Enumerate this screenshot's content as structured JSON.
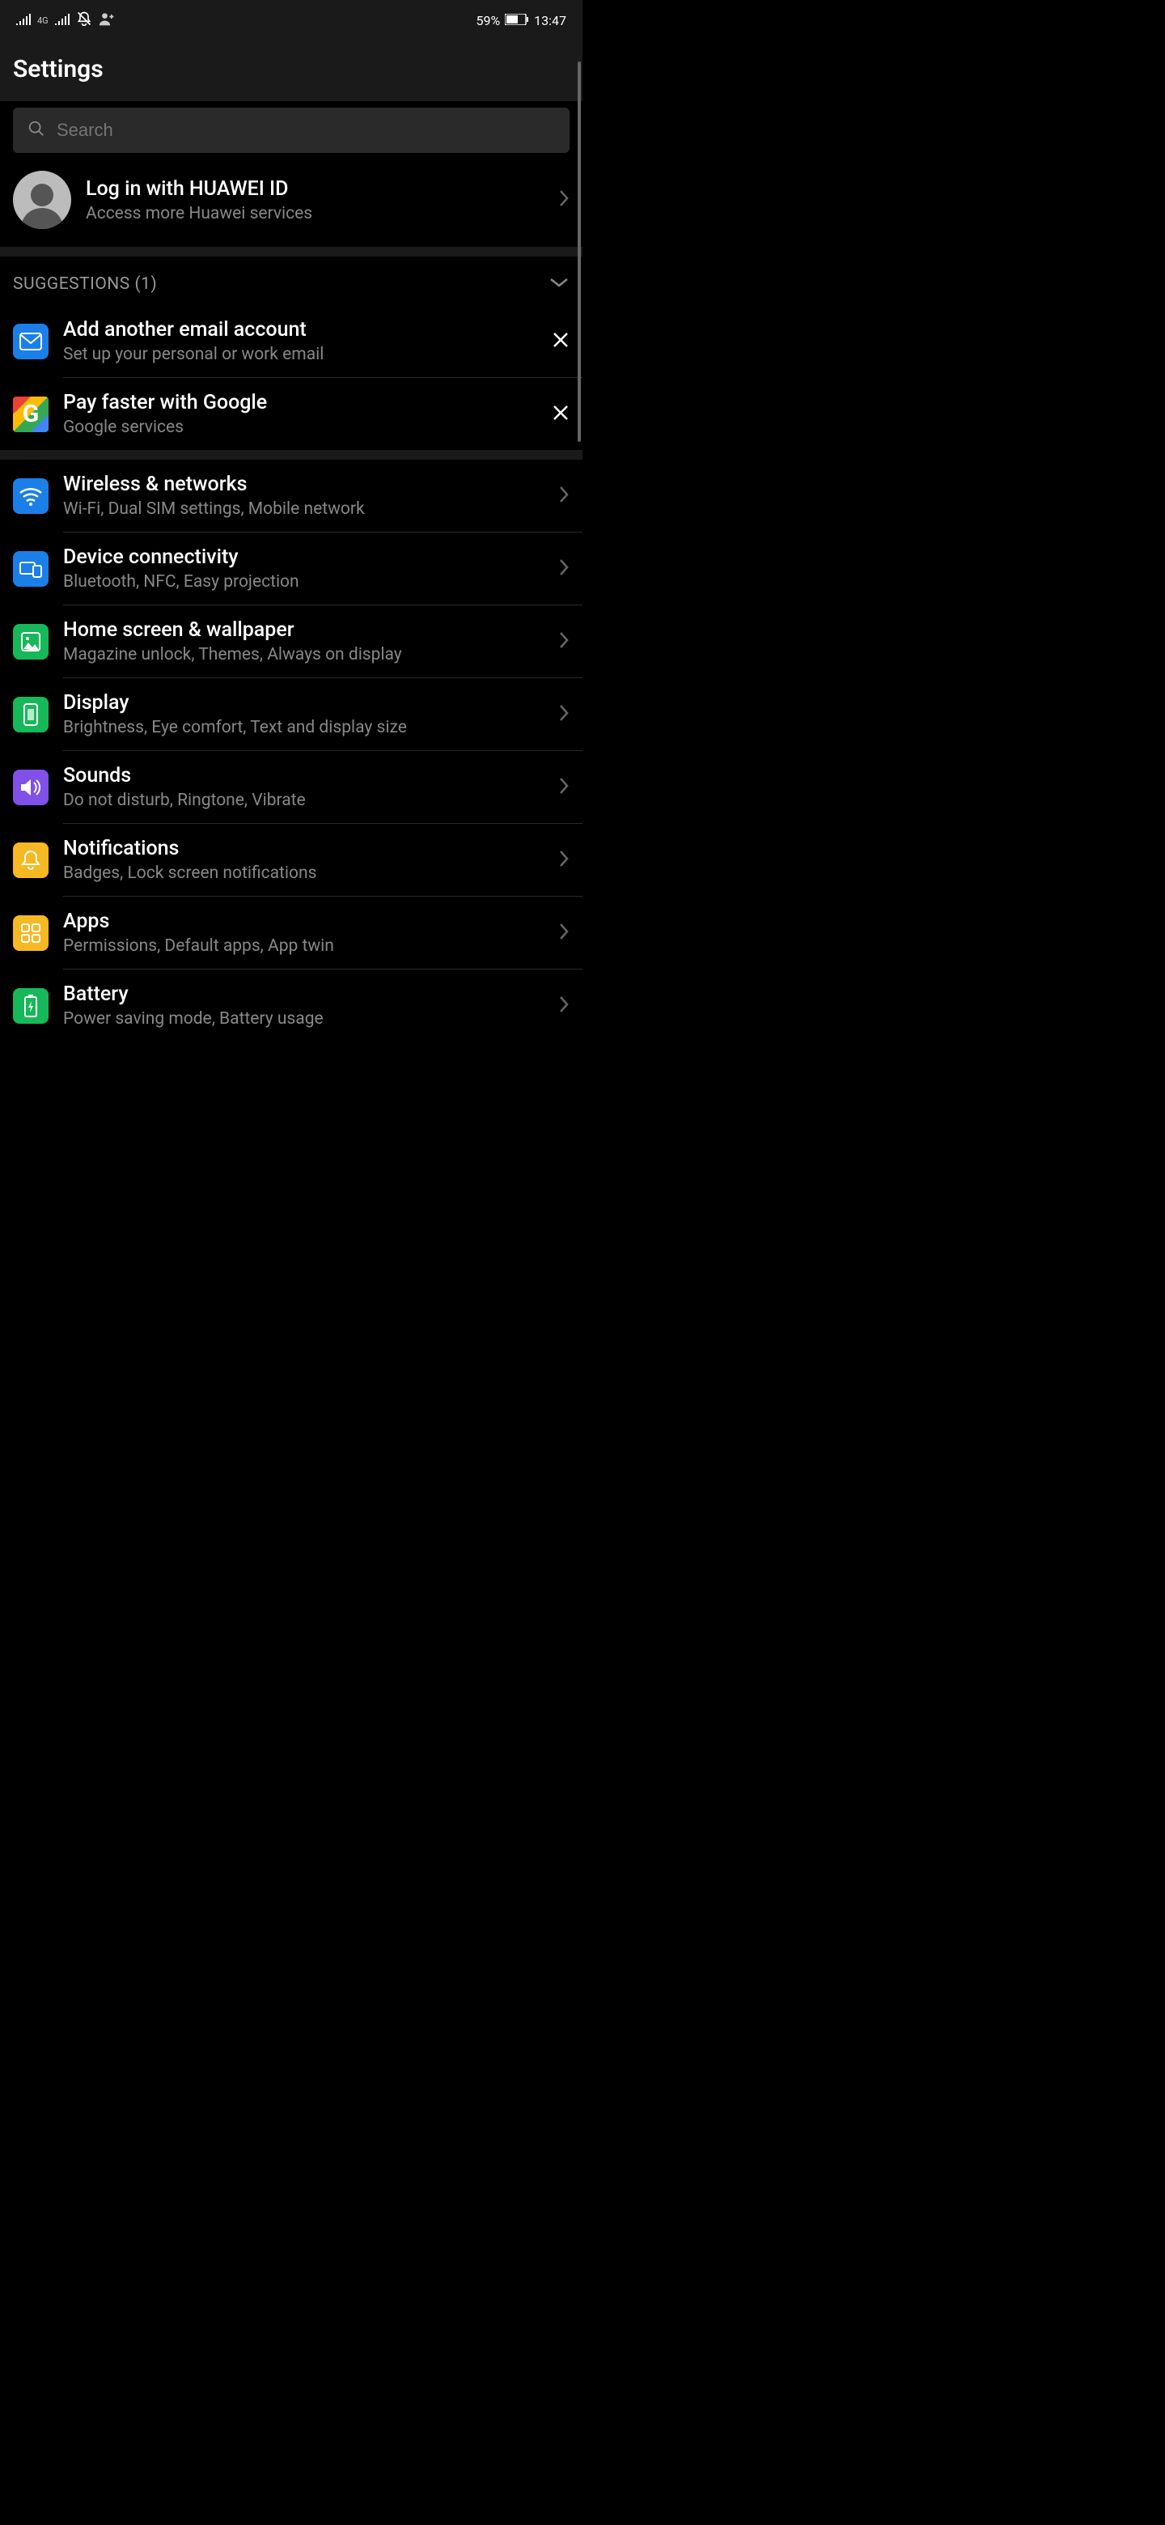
{
  "status": {
    "battery_pct": "59%",
    "time": "13:47"
  },
  "header": {
    "title": "Settings"
  },
  "search": {
    "placeholder": "Search"
  },
  "account": {
    "title": "Log in with HUAWEI ID",
    "sub": "Access more Huawei services"
  },
  "suggestions": {
    "label": "SUGGESTIONS (1)",
    "items": [
      {
        "title": "Add another email account",
        "sub": "Set up your personal or work email"
      },
      {
        "title": "Pay faster with Google",
        "sub": "Google services"
      }
    ]
  },
  "settings": [
    {
      "title": "Wireless & networks",
      "sub": "Wi-Fi, Dual SIM settings, Mobile network"
    },
    {
      "title": "Device connectivity",
      "sub": "Bluetooth, NFC, Easy projection"
    },
    {
      "title": "Home screen & wallpaper",
      "sub": "Magazine unlock, Themes, Always on display"
    },
    {
      "title": "Display",
      "sub": "Brightness, Eye comfort, Text and display size"
    },
    {
      "title": "Sounds",
      "sub": "Do not disturb, Ringtone, Vibrate"
    },
    {
      "title": "Notifications",
      "sub": "Badges, Lock screen notifications"
    },
    {
      "title": "Apps",
      "sub": "Permissions, Default apps, App twin"
    },
    {
      "title": "Battery",
      "sub": "Power saving mode, Battery usage"
    }
  ]
}
